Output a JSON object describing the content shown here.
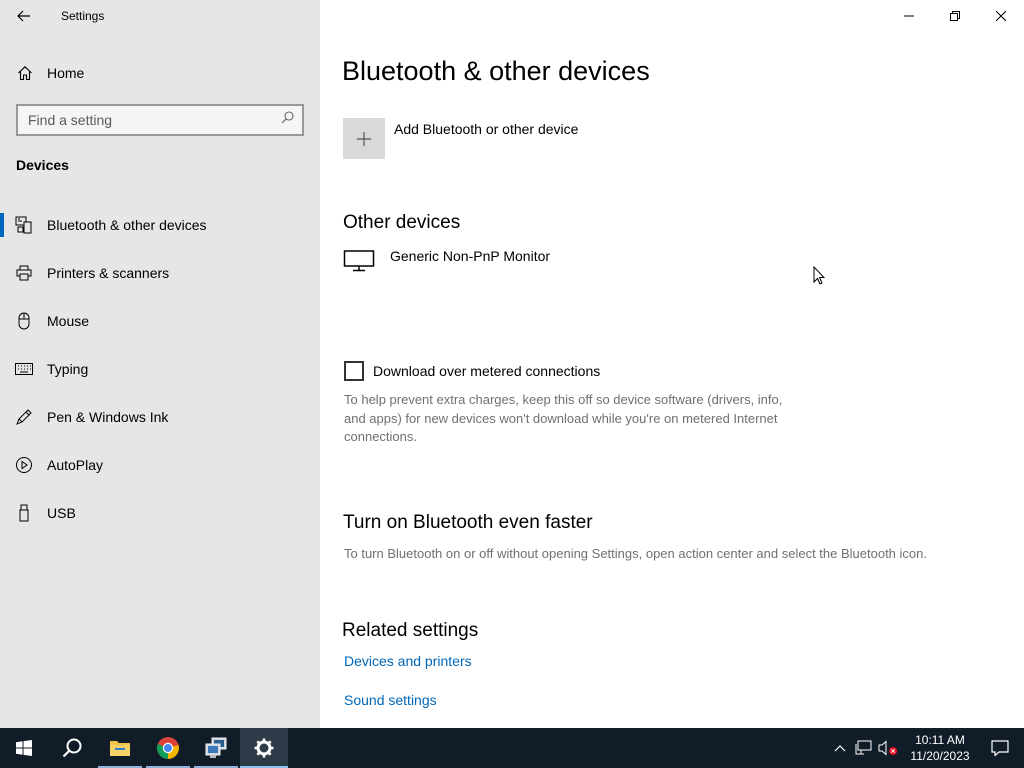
{
  "window": {
    "title": "Settings",
    "controls": [
      "minimize",
      "restore",
      "close"
    ]
  },
  "sidebar": {
    "home_label": "Home",
    "search_placeholder": "Find a setting",
    "section": "Devices",
    "items": [
      {
        "label": "Bluetooth & other devices",
        "icon": "bluetooth-devices-icon",
        "active": true
      },
      {
        "label": "Printers & scanners",
        "icon": "printer-icon",
        "active": false
      },
      {
        "label": "Mouse",
        "icon": "mouse-icon",
        "active": false
      },
      {
        "label": "Typing",
        "icon": "keyboard-icon",
        "active": false
      },
      {
        "label": "Pen & Windows Ink",
        "icon": "pen-icon",
        "active": false
      },
      {
        "label": "AutoPlay",
        "icon": "autoplay-icon",
        "active": false
      },
      {
        "label": "USB",
        "icon": "usb-icon",
        "active": false
      }
    ]
  },
  "main": {
    "title": "Bluetooth & other devices",
    "add_device_label": "Add Bluetooth or other device",
    "other_devices": {
      "title": "Other devices",
      "devices": [
        {
          "name": "Generic Non-PnP Monitor",
          "icon": "monitor-icon"
        }
      ]
    },
    "metered": {
      "label": "Download over metered connections",
      "checked": false,
      "description": "To help prevent extra charges, keep this off so device software (drivers, info, and apps) for new devices won't download while you're on metered Internet connections."
    },
    "faster": {
      "title": "Turn on Bluetooth even faster",
      "description": "To turn Bluetooth on or off without opening Settings, open action center and select the Bluetooth icon."
    },
    "related": {
      "title": "Related settings",
      "links": [
        "Devices and printers",
        "Sound settings"
      ]
    }
  },
  "taskbar": {
    "apps": [
      "start-icon",
      "search-icon",
      "file-explorer-icon",
      "chrome-icon",
      "network-app-icon",
      "settings-icon"
    ],
    "time": "10:11 AM",
    "date": "11/20/2023"
  },
  "colors": {
    "accent": "#0067c0",
    "link": "#0067b8",
    "sidebar_bg": "#e6e6e6",
    "taskbar_bg": "#101c28"
  }
}
